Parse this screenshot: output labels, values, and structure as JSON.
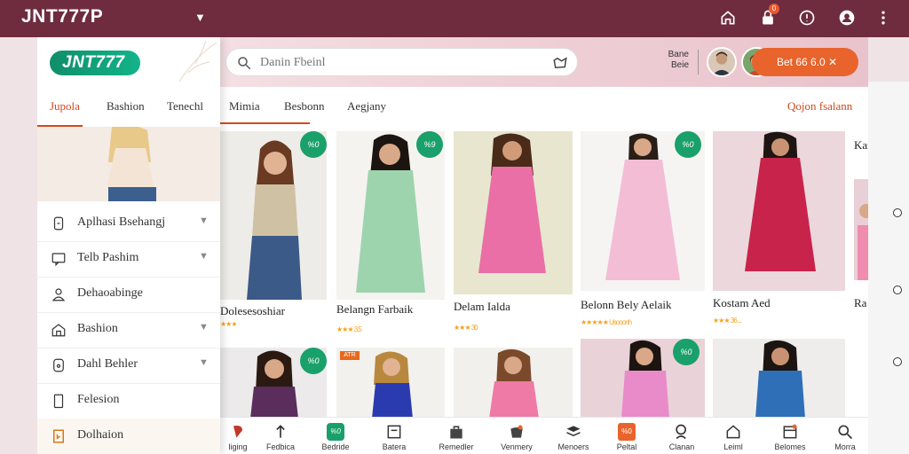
{
  "topbar": {
    "brand": "JNT777P",
    "colors": {
      "bar": "#6e2c3e",
      "accent": "#e8642c",
      "brand_green": "#13b48a"
    },
    "icons": [
      "home-icon",
      "lock-icon",
      "alert-icon",
      "user-circle-icon",
      "more-vertical-icon"
    ],
    "notif_count": "0"
  },
  "header": {
    "logo_text": "JNT777",
    "search_placeholder": "Danin Fbeinl",
    "account_label_1": "Bane",
    "account_label_2": "Beie",
    "cta_label": "Bet 66 6.0 ✕"
  },
  "tabs": [
    {
      "label": "Jupola",
      "active": true
    },
    {
      "label": "Bashion"
    },
    {
      "label": "Tenechl"
    },
    {
      "label": "Mimia"
    },
    {
      "label": "Besbonn"
    },
    {
      "label": "Aegjany"
    }
  ],
  "tab_right": "Qojon fsalann",
  "sidebar": {
    "items": [
      {
        "label": "Aplhasi Bsehangj",
        "icon": "document-icon"
      },
      {
        "label": "Telb Pashim",
        "icon": "chat-icon"
      },
      {
        "label": "Dehaoabinge",
        "icon": "user-icon"
      },
      {
        "label": "Bashion",
        "icon": "home-icon"
      },
      {
        "label": "Dahl Behler",
        "icon": "tag-icon"
      },
      {
        "label": "Felesion",
        "icon": "phone-icon"
      },
      {
        "label": "Dolhaion",
        "icon": "bookmark-icon"
      }
    ]
  },
  "products": {
    "row1": [
      {
        "name": "Dolesesoshiar",
        "meta": "★★★",
        "badge": "%0"
      },
      {
        "name": "Belangn Farbaik",
        "meta": "★★★ 3.5",
        "badge": "%9"
      },
      {
        "name": "Delam Ialda",
        "meta": "★★★ 30"
      },
      {
        "name": "Belonn Bely Aelaik",
        "meta": "★★★★★ Usooonh",
        "badge": "%0"
      },
      {
        "name": "Kostam Aed",
        "meta": "★★★ 36 ..."
      },
      {
        "name": "Kar",
        "meta": ""
      }
    ],
    "row1_extra": "Ra",
    "row2_badges": [
      "%0",
      "ATR",
      "%0",
      "%0"
    ]
  },
  "bottom_nav": [
    {
      "label": "liging",
      "icon": "pin-icon"
    },
    {
      "label": "Fedbica",
      "icon": "arrow-up-icon"
    },
    {
      "label": "Bedride",
      "icon": "badge-icon",
      "badge": "%0"
    },
    {
      "label": "Batera",
      "icon": "square-icon"
    },
    {
      "label": "Remedler",
      "icon": "bag-icon"
    },
    {
      "label": "Venmery",
      "icon": "cart-icon"
    },
    {
      "label": "Menoers",
      "icon": "stack-icon"
    },
    {
      "label": "Peltal",
      "icon": "gift-icon",
      "badge": "%0"
    },
    {
      "label": "Clanan",
      "icon": "search-icon"
    },
    {
      "label": "Leiml",
      "icon": "home-icon"
    },
    {
      "label": "Belomes",
      "icon": "calendar-icon"
    },
    {
      "label": "Morra",
      "icon": "search-icon"
    }
  ]
}
